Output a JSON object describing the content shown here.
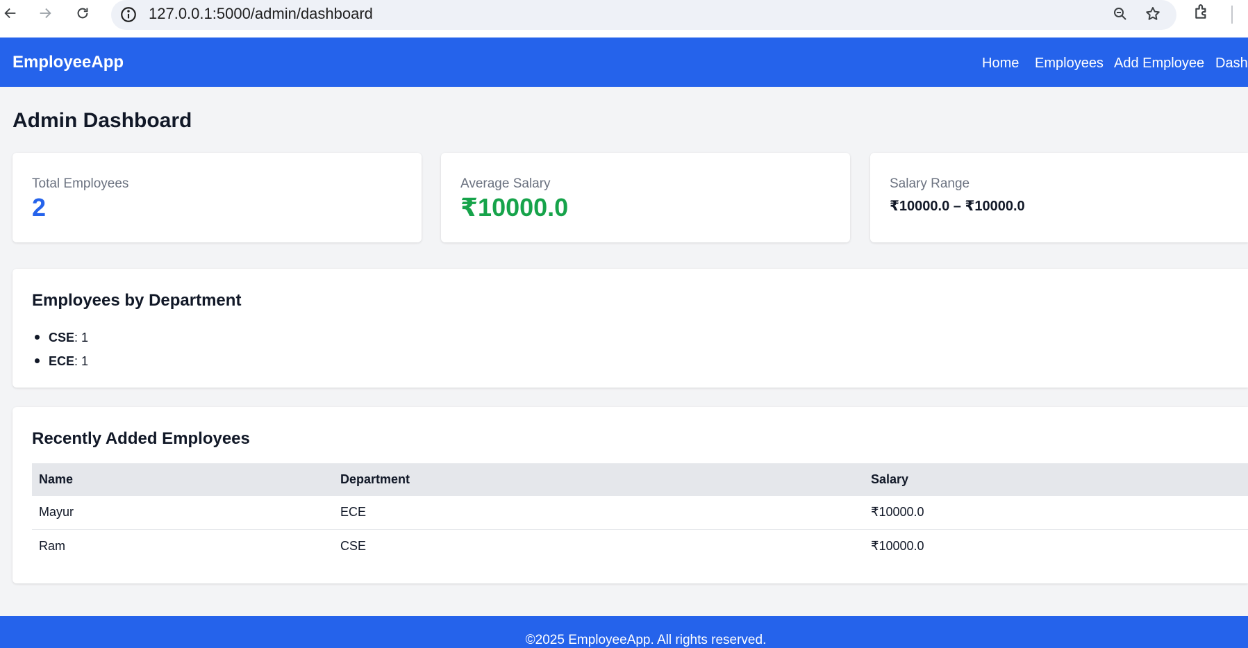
{
  "browser": {
    "url": "127.0.0.1:5000/admin/dashboard"
  },
  "navbar": {
    "brand": "EmployeeApp",
    "links": [
      {
        "label": "Home"
      },
      {
        "label": "Employees"
      },
      {
        "label": "Add Employee"
      },
      {
        "label": "Dashboard"
      }
    ]
  },
  "page": {
    "title": "Admin Dashboard"
  },
  "stats": {
    "total_employees": {
      "label": "Total Employees",
      "value": "2",
      "color": "#2563eb"
    },
    "average_salary": {
      "label": "Average Salary",
      "value": "₹10000.0",
      "color": "#16a34a"
    },
    "salary_range": {
      "label": "Salary Range",
      "value": "₹10000.0 – ₹10000.0"
    }
  },
  "departments": {
    "title": "Employees by Department",
    "items": [
      {
        "name": "CSE",
        "count": ": 1"
      },
      {
        "name": "ECE",
        "count": ": 1"
      }
    ]
  },
  "recent": {
    "title": "Recently Added Employees",
    "columns": [
      "Name",
      "Department",
      "Salary"
    ],
    "rows": [
      {
        "name": "Mayur",
        "department": "ECE",
        "salary": "₹10000.0"
      },
      {
        "name": "Ram",
        "department": "CSE",
        "salary": "₹10000.0"
      }
    ]
  },
  "footer": {
    "text": "©2025 EmployeeApp. All rights reserved."
  },
  "theme": {
    "primary": "#2563eb",
    "background": "#f3f4f6"
  }
}
